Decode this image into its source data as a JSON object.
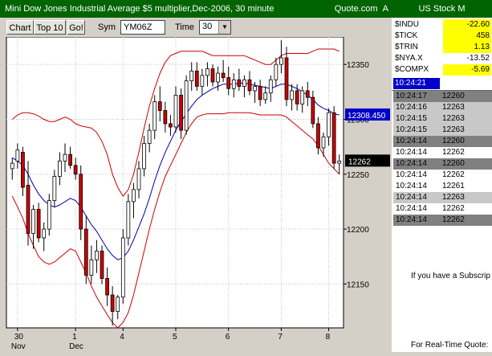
{
  "title": "Mini Dow Jones Industrial Average $5 multiplier,Dec-2006, 30 minute",
  "brand": "Quote.com",
  "brand_mark": "A",
  "toolbar": {
    "chart_label": "Chart",
    "top10_label": "Top 10",
    "go_label": "Go!",
    "sym_label": "Sym",
    "sym_value": "YM06Z",
    "time_label": "Time",
    "time_value": "30"
  },
  "colors": {
    "titlebar": "#006400",
    "candle_up": "#ffffff",
    "candle_down": "#cc0000",
    "band": "#cc0000",
    "moving_average": "#0000aa",
    "highlight": "#ffff00",
    "time_badge": "#0000c8"
  },
  "chart_data": {
    "type": "candlestick",
    "ylim": [
      12110,
      12375
    ],
    "y_ticks": [
      "12350",
      "12300",
      "12250",
      "12200",
      "12150"
    ],
    "x_ticks": [
      {
        "day": "30",
        "month": "Nov"
      },
      {
        "day": "1",
        "month": "Dec"
      },
      {
        "day": "4",
        "month": ""
      },
      {
        "day": "5",
        "month": ""
      },
      {
        "day": "6",
        "month": ""
      },
      {
        "day": "7",
        "month": ""
      },
      {
        "day": "8",
        "month": ""
      }
    ],
    "x_tick_bar_index": [
      1,
      12,
      21,
      31,
      41,
      51,
      60
    ],
    "ma_value_label": "12308.450",
    "last_price_label": "12262",
    "candles": [
      {
        "o": 12255,
        "h": 12265,
        "l": 12245,
        "c": 12260
      },
      {
        "o": 12262,
        "h": 12278,
        "l": 12255,
        "c": 12272
      },
      {
        "o": 12270,
        "h": 12275,
        "l": 12230,
        "c": 12238
      },
      {
        "o": 12240,
        "h": 12262,
        "l": 12185,
        "c": 12196
      },
      {
        "o": 12196,
        "h": 12222,
        "l": 12182,
        "c": 12218
      },
      {
        "o": 12218,
        "h": 12224,
        "l": 12188,
        "c": 12192
      },
      {
        "o": 12192,
        "h": 12206,
        "l": 12180,
        "c": 12200
      },
      {
        "o": 12200,
        "h": 12232,
        "l": 12194,
        "c": 12226
      },
      {
        "o": 12226,
        "h": 12254,
        "l": 12220,
        "c": 12248
      },
      {
        "o": 12248,
        "h": 12270,
        "l": 12240,
        "c": 12262
      },
      {
        "o": 12262,
        "h": 12278,
        "l": 12252,
        "c": 12268
      },
      {
        "o": 12268,
        "h": 12275,
        "l": 12255,
        "c": 12258
      },
      {
        "o": 12258,
        "h": 12265,
        "l": 12245,
        "c": 12250
      },
      {
        "o": 12250,
        "h": 12258,
        "l": 12190,
        "c": 12200
      },
      {
        "o": 12200,
        "h": 12212,
        "l": 12150,
        "c": 12158
      },
      {
        "o": 12158,
        "h": 12185,
        "l": 12150,
        "c": 12172
      },
      {
        "o": 12172,
        "h": 12190,
        "l": 12160,
        "c": 12180
      },
      {
        "o": 12180,
        "h": 12185,
        "l": 12150,
        "c": 12155
      },
      {
        "o": 12155,
        "h": 12165,
        "l": 12130,
        "c": 12140
      },
      {
        "o": 12140,
        "h": 12148,
        "l": 12112,
        "c": 12125
      },
      {
        "o": 12125,
        "h": 12140,
        "l": 12118,
        "c": 12138
      },
      {
        "o": 12138,
        "h": 12200,
        "l": 12132,
        "c": 12192
      },
      {
        "o": 12192,
        "h": 12232,
        "l": 12185,
        "c": 12225
      },
      {
        "o": 12225,
        "h": 12242,
        "l": 12210,
        "c": 12236
      },
      {
        "o": 12236,
        "h": 12262,
        "l": 12228,
        "c": 12255
      },
      {
        "o": 12255,
        "h": 12285,
        "l": 12248,
        "c": 12278
      },
      {
        "o": 12278,
        "h": 12296,
        "l": 12270,
        "c": 12290
      },
      {
        "o": 12290,
        "h": 12322,
        "l": 12282,
        "c": 12316
      },
      {
        "o": 12316,
        "h": 12330,
        "l": 12298,
        "c": 12308
      },
      {
        "o": 12308,
        "h": 12316,
        "l": 12288,
        "c": 12296
      },
      {
        "o": 12296,
        "h": 12304,
        "l": 12285,
        "c": 12293
      },
      {
        "o": 12293,
        "h": 12330,
        "l": 12288,
        "c": 12322
      },
      {
        "o": 12322,
        "h": 12328,
        "l": 12282,
        "c": 12290
      },
      {
        "o": 12290,
        "h": 12340,
        "l": 12286,
        "c": 12335
      },
      {
        "o": 12335,
        "h": 12352,
        "l": 12326,
        "c": 12344
      },
      {
        "o": 12344,
        "h": 12352,
        "l": 12326,
        "c": 12330
      },
      {
        "o": 12330,
        "h": 12346,
        "l": 12322,
        "c": 12340
      },
      {
        "o": 12340,
        "h": 12352,
        "l": 12330,
        "c": 12346
      },
      {
        "o": 12346,
        "h": 12350,
        "l": 12330,
        "c": 12334
      },
      {
        "o": 12334,
        "h": 12348,
        "l": 12326,
        "c": 12342
      },
      {
        "o": 12342,
        "h": 12354,
        "l": 12334,
        "c": 12338
      },
      {
        "o": 12338,
        "h": 12348,
        "l": 12322,
        "c": 12328
      },
      {
        "o": 12328,
        "h": 12342,
        "l": 12320,
        "c": 12336
      },
      {
        "o": 12336,
        "h": 12346,
        "l": 12326,
        "c": 12330
      },
      {
        "o": 12330,
        "h": 12340,
        "l": 12320,
        "c": 12336
      },
      {
        "o": 12336,
        "h": 12344,
        "l": 12322,
        "c": 12326
      },
      {
        "o": 12326,
        "h": 12334,
        "l": 12315,
        "c": 12330
      },
      {
        "o": 12330,
        "h": 12336,
        "l": 12312,
        "c": 12318
      },
      {
        "o": 12318,
        "h": 12330,
        "l": 12314,
        "c": 12324
      },
      {
        "o": 12324,
        "h": 12340,
        "l": 12316,
        "c": 12336
      },
      {
        "o": 12336,
        "h": 12356,
        "l": 12330,
        "c": 12350
      },
      {
        "o": 12350,
        "h": 12372,
        "l": 12342,
        "c": 12356
      },
      {
        "o": 12356,
        "h": 12366,
        "l": 12312,
        "c": 12318
      },
      {
        "o": 12318,
        "h": 12332,
        "l": 12308,
        "c": 12326
      },
      {
        "o": 12326,
        "h": 12332,
        "l": 12308,
        "c": 12314
      },
      {
        "o": 12314,
        "h": 12330,
        "l": 12306,
        "c": 12326
      },
      {
        "o": 12326,
        "h": 12334,
        "l": 12312,
        "c": 12320
      },
      {
        "o": 12320,
        "h": 12326,
        "l": 12292,
        "c": 12296
      },
      {
        "o": 12296,
        "h": 12302,
        "l": 12268,
        "c": 12274
      },
      {
        "o": 12274,
        "h": 12288,
        "l": 12266,
        "c": 12284
      },
      {
        "o": 12284,
        "h": 12310,
        "l": 12276,
        "c": 12306
      },
      {
        "o": 12306,
        "h": 12312,
        "l": 12255,
        "c": 12260
      },
      {
        "o": 12260,
        "h": 12268,
        "l": 12250,
        "c": 12262
      }
    ],
    "moving_average": [
      12265,
      12262,
      12258,
      12250,
      12240,
      12232,
      12226,
      12222,
      12220,
      12222,
      12225,
      12228,
      12226,
      12220,
      12212,
      12204,
      12198,
      12190,
      12182,
      12176,
      12172,
      12174,
      12180,
      12190,
      12202,
      12214,
      12228,
      12244,
      12258,
      12270,
      12280,
      12290,
      12298,
      12305,
      12312,
      12318,
      12322,
      12325,
      12328,
      12330,
      12332,
      12332,
      12332,
      12333,
      12333,
      12332,
      12331,
      12330,
      12329,
      12328,
      12330,
      12332,
      12332,
      12330,
      12328,
      12325,
      12322,
      12318,
      12313,
      12310,
      12308,
      12305,
      12304
    ],
    "upper_band": [
      12300,
      12304,
      12306,
      12306,
      12305,
      12303,
      12300,
      12298,
      12298,
      12300,
      12302,
      12300,
      12296,
      12294,
      12293,
      12292,
      12288,
      12280,
      12268,
      12250,
      12238,
      12230,
      12236,
      12250,
      12270,
      12292,
      12312,
      12328,
      12342,
      12352,
      12358,
      12360,
      12362,
      12362,
      12362,
      12362,
      12362,
      12360,
      12358,
      12358,
      12358,
      12358,
      12358,
      12358,
      12358,
      12356,
      12354,
      12352,
      12350,
      12350,
      12354,
      12358,
      12360,
      12360,
      12360,
      12360,
      12360,
      12362,
      12364,
      12364,
      12364,
      12364,
      12362
    ],
    "lower_band": [
      12230,
      12220,
      12210,
      12196,
      12185,
      12175,
      12170,
      12168,
      12170,
      12174,
      12178,
      12182,
      12180,
      12170,
      12160,
      12148,
      12138,
      12130,
      12122,
      12115,
      12110,
      12115,
      12124,
      12140,
      12160,
      12180,
      12200,
      12218,
      12234,
      12248,
      12258,
      12268,
      12278,
      12288,
      12296,
      12302,
      12304,
      12305,
      12305,
      12305,
      12305,
      12306,
      12306,
      12306,
      12306,
      12306,
      12305,
      12304,
      12304,
      12304,
      12304,
      12304,
      12302,
      12298,
      12294,
      12290,
      12286,
      12282,
      12276,
      12268,
      12260,
      12255,
      12250
    ]
  },
  "quotes_panel": {
    "header": "US Stock M",
    "quotes": [
      {
        "symbol": "$INDU",
        "value": "-22.60",
        "highlight": true
      },
      {
        "symbol": "$TICK",
        "value": "458",
        "highlight": true
      },
      {
        "symbol": "$TRIN",
        "value": "1.13",
        "highlight": true
      },
      {
        "symbol": "$NYA.X",
        "value": "-13.52",
        "highlight": false
      },
      {
        "symbol": "$COMPX",
        "value": "-5.69",
        "highlight": true
      }
    ],
    "current_time": "10:24:21",
    "time_sales": [
      {
        "time": "10:24:17",
        "price": "12260",
        "style": "dark"
      },
      {
        "time": "10:24:16",
        "price": "12263",
        "style": "light"
      },
      {
        "time": "10:24:15",
        "price": "12263",
        "style": "light"
      },
      {
        "time": "10:24:15",
        "price": "12263",
        "style": "light"
      },
      {
        "time": "10:24:14",
        "price": "12260",
        "style": "dark"
      },
      {
        "time": "10:24:14",
        "price": "12262",
        "style": "white"
      },
      {
        "time": "10:24:14",
        "price": "12260",
        "style": "dark"
      },
      {
        "time": "10:24:14",
        "price": "12262",
        "style": "white"
      },
      {
        "time": "10:24:14",
        "price": "12261",
        "style": "white"
      },
      {
        "time": "10:24:14",
        "price": "12263",
        "style": "light"
      },
      {
        "time": "10:24:14",
        "price": "12262",
        "style": "white"
      },
      {
        "time": "10:24:14",
        "price": "12262",
        "style": "dark"
      }
    ],
    "message1": "If you have a Subscrip",
    "message2": "For Real-Time Quote:"
  }
}
